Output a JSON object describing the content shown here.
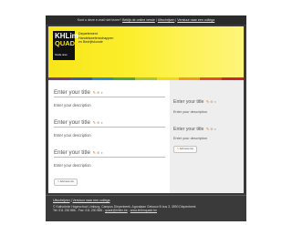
{
  "topbar": {
    "prefix": "Kunt u deze e-mail niet lezen?",
    "link1": "Bekijk de online versie",
    "sep1": "|",
    "link2": "Uitschrijven",
    "sep2": "|",
    "link3": "Verstuur naar een collega"
  },
  "banner": {
    "logo_top": "KHLim",
    "logo_bottom": "QUADR",
    "logo_sub": "Studie doen",
    "dept_lines": [
      "Departement",
      "Handelswetenschappen",
      "en Bedrijfskunde"
    ]
  },
  "color_strip": [
    "#7a3b7a",
    "#3a5ea8",
    "#2f8bc9",
    "#4aa84a",
    "#a8c83a",
    "#f0d81a",
    "#f29a1a",
    "#e0502a",
    "#c8282a"
  ],
  "main": {
    "blocks": [
      {
        "title": "Enter your title",
        "desc": "Enter your description"
      },
      {
        "title": "Enter your title",
        "desc": "Enter your description"
      },
      {
        "title": "Enter your title",
        "desc": "Enter your description"
      }
    ],
    "add_button": "Add new row"
  },
  "sidebar": {
    "blocks": [
      {
        "title": "Enter your title",
        "desc": "Enter your description"
      },
      {
        "title": "Enter your title",
        "desc": "Enter your description"
      }
    ],
    "add_button": "Add new row"
  },
  "footer": {
    "link1": "Uitschrijven",
    "sep": "|",
    "link2": "Verstuur naar een collega",
    "address": "© Katholieke Hogeschool Limburg, Campus Diepenbeek, Agoralaan Gebouw B bus 3, 3590 Diepenbeek",
    "contact_tel": "Tel: 011 230 886 - Fax: 011 230 886 - ",
    "contact_email": "quadr@khlim.be",
    "contact_sep": " - ",
    "contact_web": "www.khlimquadr.be"
  }
}
